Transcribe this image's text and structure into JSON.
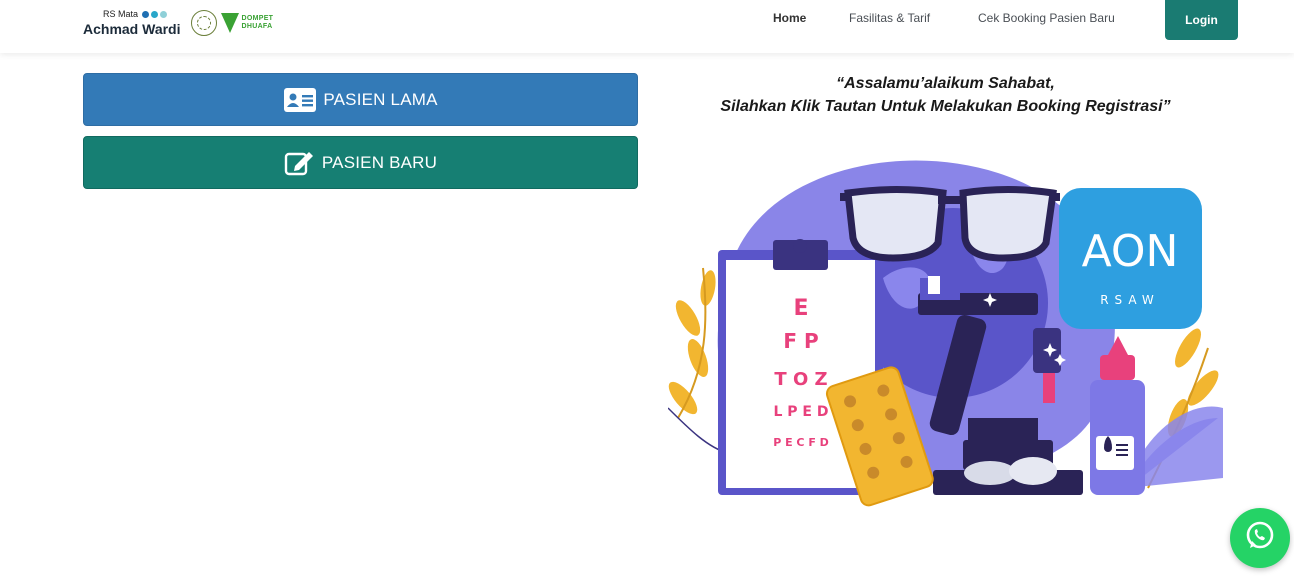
{
  "header": {
    "brand": {
      "small_text": "RS Mata",
      "big_text": "Achmad Wardi",
      "partner_line1": "DOMPET",
      "partner_line2": "DHUAFA",
      "dot_colors": [
        "#1f6fb2",
        "#2aa7c9",
        "#8fd0d8"
      ]
    },
    "nav": [
      {
        "label": "Home",
        "active": true
      },
      {
        "label": "Fasilitas & Tarif",
        "active": false
      },
      {
        "label": "Cek Booking Pasien Baru",
        "active": false
      }
    ],
    "login_label": "Login"
  },
  "main": {
    "btn_lama": {
      "label": "PASIEN LAMA",
      "icon": "id-card-icon",
      "color": "#337ab7"
    },
    "btn_baru": {
      "label": "PASIEN BARU",
      "icon": "edit-icon",
      "color": "#167f73"
    },
    "greeting_line1": "“Assalamu’alaikum Sahabat,",
    "greeting_line2": "Silahkan Klik Tautan Untuk Melakukan Booking Registrasi”",
    "illustration": {
      "eye_chart_rows": [
        "E",
        "F P",
        "T O Z",
        "L P E D",
        "P E C F D"
      ],
      "app_badge_big": "AON",
      "app_badge_small": "RSAW",
      "accent_color": "#7d78e6"
    }
  },
  "whatsapp": {
    "icon": "whatsapp-icon",
    "color": "#25d366"
  }
}
